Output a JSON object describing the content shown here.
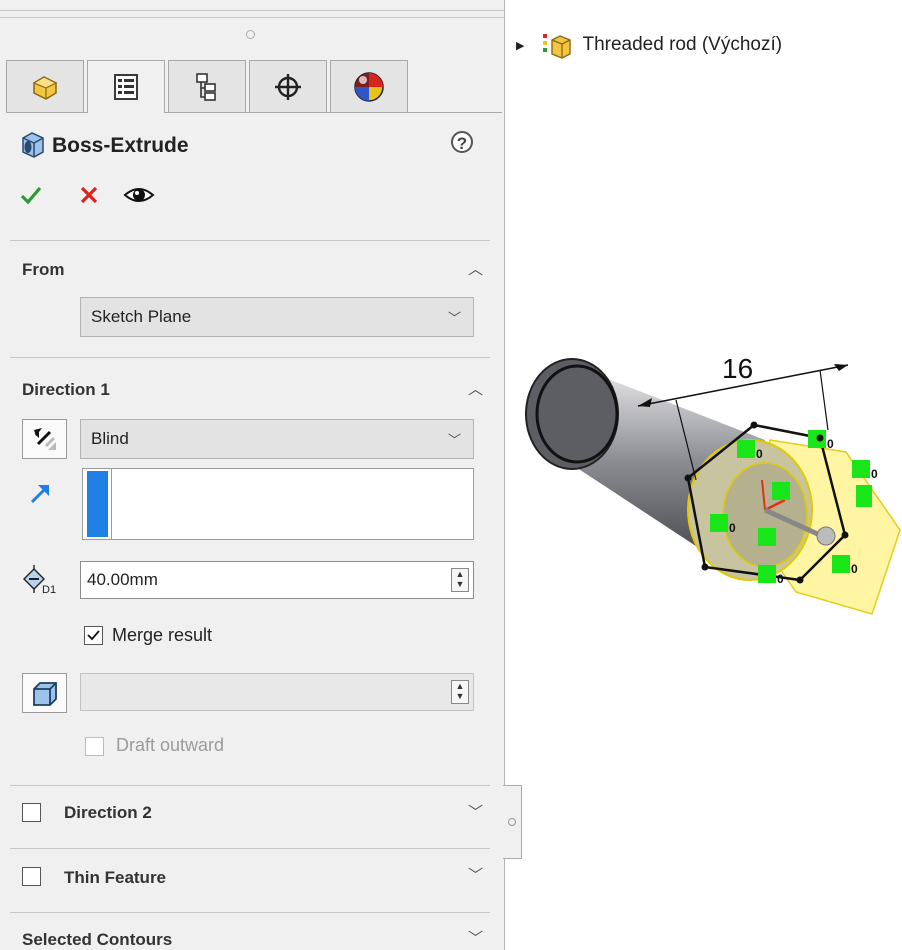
{
  "feature": {
    "title": "Boss-Extrude",
    "help_glyph": "?"
  },
  "tabs": [
    {
      "name": "featuremanager-tab",
      "icon": "part-icon"
    },
    {
      "name": "propertymanager-tab",
      "icon": "property-manager-icon"
    },
    {
      "name": "configurationmanager-tab",
      "icon": "configuration-icon"
    },
    {
      "name": "dimxpert-tab",
      "icon": "crosshair-icon"
    },
    {
      "name": "display-manager-tab",
      "icon": "appearance-sphere-icon"
    }
  ],
  "from": {
    "title": "From",
    "value": "Sketch Plane"
  },
  "direction1": {
    "title": "Direction 1",
    "end_condition": "Blind",
    "depth": "40.00mm",
    "merge_label": "Merge result",
    "merge_checked": true,
    "draft_label": "Draft outward"
  },
  "direction2": {
    "title": "Direction 2"
  },
  "thin": {
    "title": "Thin Feature"
  },
  "contours": {
    "title": "Selected Contours"
  },
  "tree": {
    "label": "Threaded rod  (Výchozí)"
  },
  "viewport": {
    "dimension": "16",
    "relation_label": "0"
  },
  "colors": {
    "accept": "#2e9b2e",
    "cancel": "#d9231b",
    "selection_blue": "#1e7fe5",
    "highlight_yellow": "#fff59a",
    "relation_green": "#19e619"
  }
}
